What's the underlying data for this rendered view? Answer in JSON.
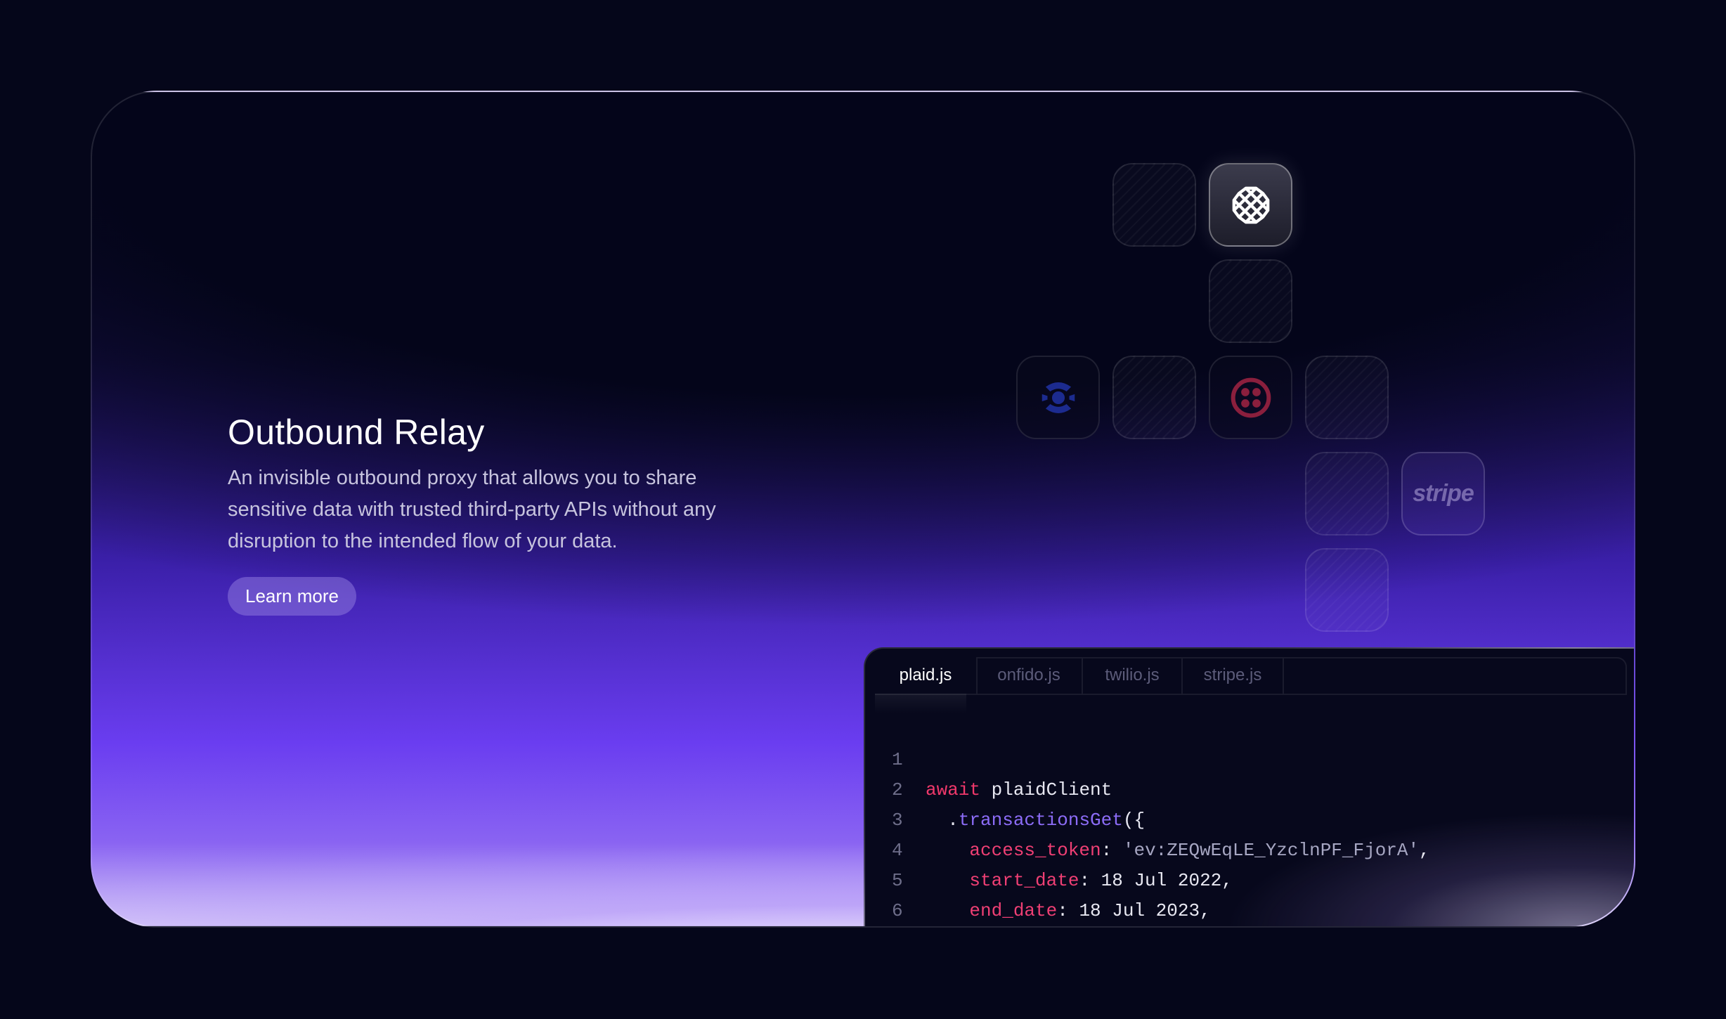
{
  "hero": {
    "title": "Outbound Relay",
    "description": "An invisible outbound proxy that allows you to share sensitive data with trusted third-party APIs without any disruption to the intended flow of your data.",
    "cta_label": "Learn more"
  },
  "integrations": {
    "tiles": [
      {
        "name": "plaid",
        "icon": "plaid-logo-icon",
        "active": true
      },
      {
        "name": "onfido",
        "icon": "onfido-logo-icon",
        "active": false
      },
      {
        "name": "twilio",
        "icon": "twilio-logo-icon",
        "active": false
      },
      {
        "name": "stripe",
        "wordmark": "stripe",
        "active": false
      }
    ]
  },
  "code_panel": {
    "tabs": [
      {
        "label": "plaid.js",
        "active": true
      },
      {
        "label": "onfido.js",
        "active": false
      },
      {
        "label": "twilio.js",
        "active": false
      },
      {
        "label": "stripe.js",
        "active": false
      }
    ],
    "lines": [
      {
        "num": "1",
        "t1": "await",
        "t2": " plaidClient"
      },
      {
        "num": "2",
        "t1": "  .",
        "t2": "transactionsGet",
        "t3": "({"
      },
      {
        "num": "3",
        "t1": "    access_token",
        "t2": ": ",
        "t3": "'ev:ZEQwEqLE_YzclnPF_FjorA'",
        "t4": ","
      },
      {
        "num": "4",
        "t1": "    start_date",
        "t2": ": 18 Jul 2022,"
      },
      {
        "num": "5",
        "t1": "    end_date",
        "t2": ": 18 Jul 2023,"
      },
      {
        "num": "6",
        "t1": "  });"
      }
    ]
  },
  "colors": {
    "background": "#05061a",
    "accent_purple": "#6a3df0",
    "keyword": "#f0386b",
    "function": "#8c6cf7"
  }
}
